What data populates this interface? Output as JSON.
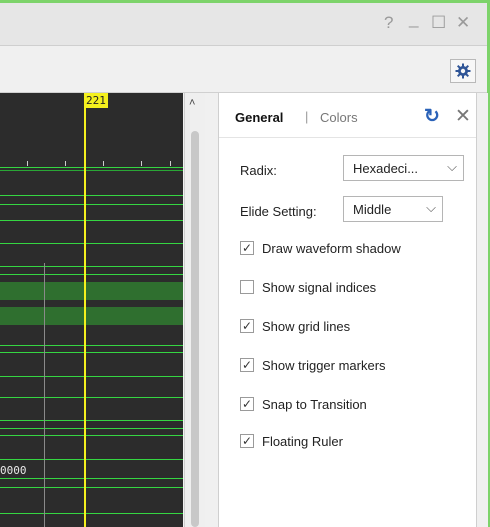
{
  "window": {
    "controls": {
      "help": "?",
      "minimize": "_",
      "maximize": "☐",
      "close": "✕"
    }
  },
  "toolbar": {
    "settings_icon": "gear-icon"
  },
  "waveform": {
    "cursor_label": "221",
    "value_text": "0000",
    "trace_color": "#35d642",
    "cursor_color": "#f4f01e"
  },
  "panel": {
    "tabs": {
      "general": "General",
      "separator": "|",
      "colors": "Colors"
    },
    "refresh_icon": "refresh-icon",
    "close_icon": "close-icon",
    "radix": {
      "label": "Radix:",
      "value": "Hexadeci..."
    },
    "elide": {
      "label": "Elide Setting:",
      "value": "Middle"
    },
    "options": [
      {
        "label": "Draw waveform shadow",
        "checked": true
      },
      {
        "label": "Show signal indices",
        "checked": false
      },
      {
        "label": "Show grid lines",
        "checked": true
      },
      {
        "label": "Show trigger markers",
        "checked": true
      },
      {
        "label": "Snap to Transition",
        "checked": true
      },
      {
        "label": "Floating Ruler",
        "checked": true
      }
    ],
    "accent_color": "#2a62b8"
  }
}
